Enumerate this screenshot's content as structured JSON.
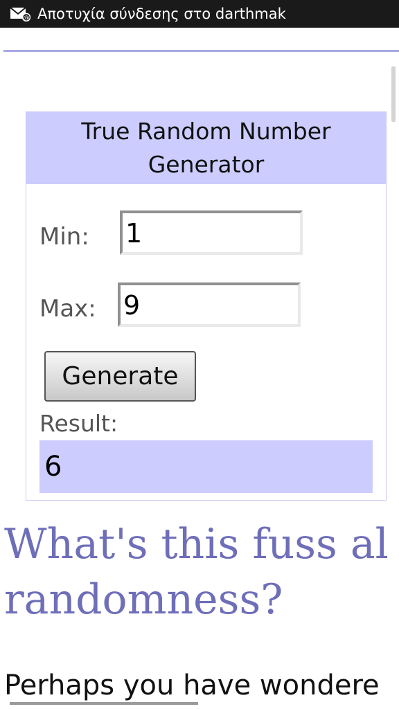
{
  "status_bar": {
    "notification_text": "Αποτυχία σύνδεσης στο darthmak",
    "icon": "mail-alert-icon"
  },
  "widget": {
    "title": "True Random Number Generator",
    "min_label": "Min:",
    "min_value": "1",
    "max_label": "Max:",
    "max_value": "9",
    "generate_label": "Generate",
    "result_label": "Result:",
    "result_value": "6",
    "colors": {
      "header_bg": "#ccccff",
      "result_bg": "#ccccff"
    }
  },
  "article": {
    "heading": "What's this fuss about randomness?",
    "heading_line1": "What's this fuss al",
    "heading_line2": "randomness?",
    "intro": "Perhaps you have wondere",
    "colors": {
      "heading": "#6e6eb9"
    }
  }
}
